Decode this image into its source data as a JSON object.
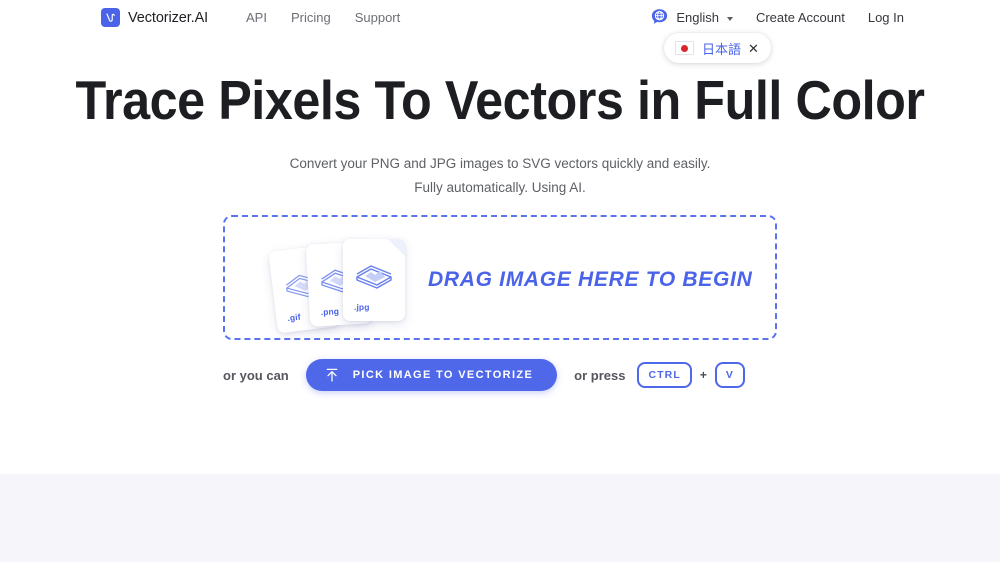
{
  "header": {
    "brand": {
      "name": "Vectorizer.AI",
      "logo_icon": "vectorizer-logo-icon",
      "logo_color": "#4a63e8"
    },
    "nav": [
      {
        "label": "API"
      },
      {
        "label": "Pricing"
      },
      {
        "label": "Support"
      }
    ],
    "language": {
      "icon": "globe-icon",
      "label": "English",
      "caret_icon": "chevron-down-icon"
    },
    "account": [
      {
        "label": "Create Account"
      },
      {
        "label": "Log In"
      }
    ],
    "language_popup": {
      "flag_icon": "flag-japan-icon",
      "label": "日本語",
      "close_icon": "close-icon",
      "link_color": "#4a63e8"
    }
  },
  "hero": {
    "title": "Trace Pixels To Vectors in Full Color",
    "subtitle_line1": "Convert your PNG and JPG images to SVG vectors quickly and easily.",
    "subtitle_line2": "Fully automatically. Using AI."
  },
  "dropzone": {
    "prompt": "DRAG IMAGE HERE TO BEGIN",
    "border_color": "#5b74ee",
    "cards": [
      {
        "ext": ".gif",
        "icon": "image-file-icon"
      },
      {
        "ext": ".png",
        "icon": "image-file-icon"
      },
      {
        "ext": ".jpg",
        "icon": "image-file-icon"
      }
    ]
  },
  "actions": {
    "or_you_can": "or you can",
    "pick_button": {
      "label": "PICK IMAGE TO VECTORIZE",
      "icon": "upload-icon",
      "color": "#4f68ea"
    },
    "or_press": "or press",
    "keys": [
      {
        "label": "CTRL"
      },
      {
        "label": "V"
      }
    ],
    "key_separator": "+"
  },
  "lower_section": {
    "background": "#f5f5fa"
  }
}
